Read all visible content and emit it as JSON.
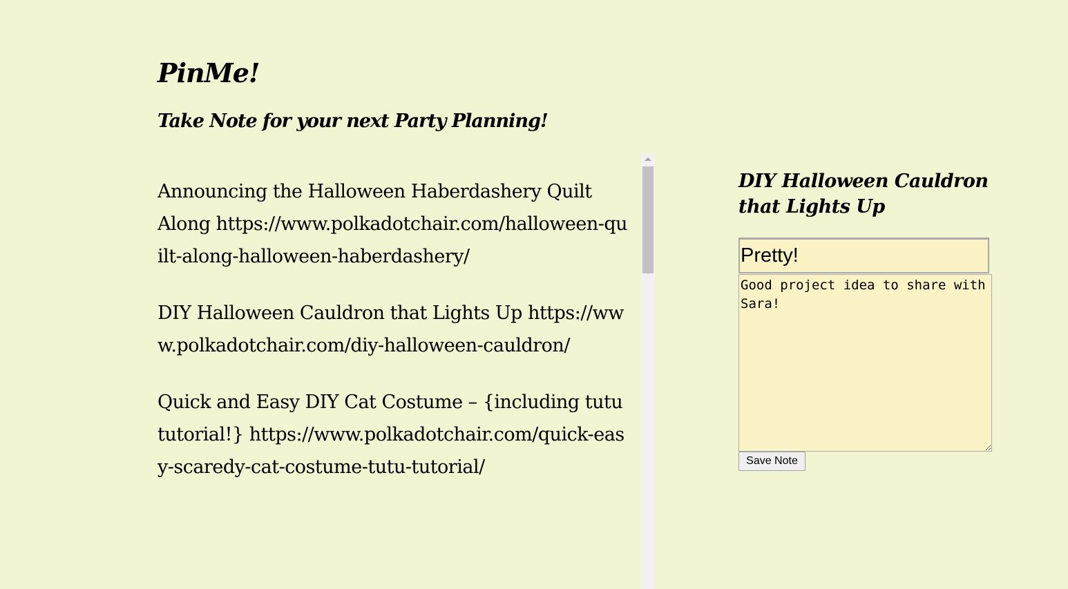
{
  "header": {
    "title": "PinMe!",
    "subtitle": "Take Note for your next Party Planning!"
  },
  "pins": [
    {
      "title": "Announcing the Halloween Haberdashery Quilt Along",
      "url": "https://www.polkadotchair.com/halloween-quilt-along-halloween-haberdashery/"
    },
    {
      "title": "DIY Halloween Cauldron that Lights Up",
      "url": "https://www.polkadotchair.com/diy-halloween-cauldron/"
    },
    {
      "title": "Quick and Easy DIY Cat Costume – {including tutu tutorial!}",
      "url": "https://www.polkadotchair.com/quick-easy-scaredy-cat-costume-tutu-tutorial/"
    }
  ],
  "note": {
    "heading": "DIY Halloween Cauldron that Lights Up",
    "title_value": "Pretty!",
    "body_value": "Good project idea to share with Sara!",
    "save_label": "Save Note"
  },
  "colors": {
    "page_background": "#f1f5d1",
    "field_background": "#fbf3c6"
  }
}
